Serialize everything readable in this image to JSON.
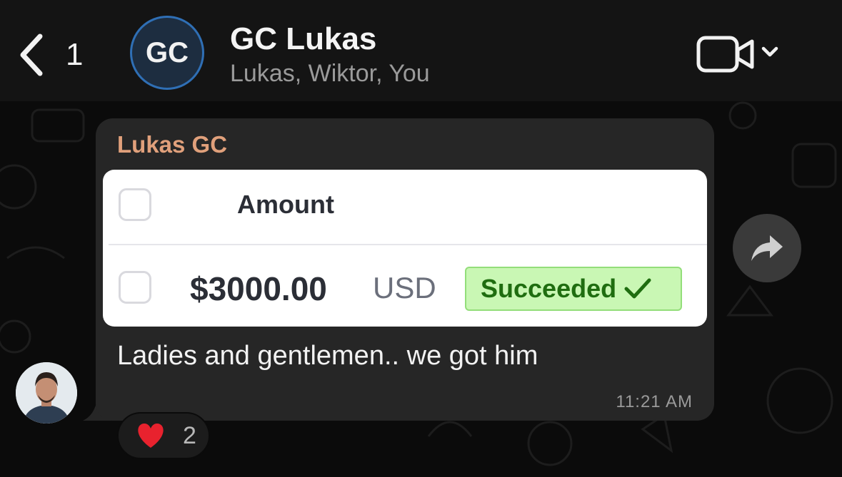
{
  "header": {
    "back_count": "1",
    "avatar_initials": "GC",
    "title": "GC Lukas",
    "subtitle": "Lukas, Wiktor, You"
  },
  "message": {
    "sender": "Lukas GC",
    "card": {
      "column_header": "Amount",
      "amount": "$3000.00",
      "currency": "USD",
      "status": "Succeeded"
    },
    "text": "Ladies and gentlemen.. we got him",
    "time": "11:21 AM",
    "reaction": {
      "emoji_icon": "heart-icon",
      "count": "2"
    }
  },
  "colors": {
    "sender_name": "#e0a07b",
    "bubble": "#262626",
    "status_bg": "#c9f7b4",
    "status_text": "#1f6d10",
    "avatar_ring": "#2f6fb5"
  }
}
